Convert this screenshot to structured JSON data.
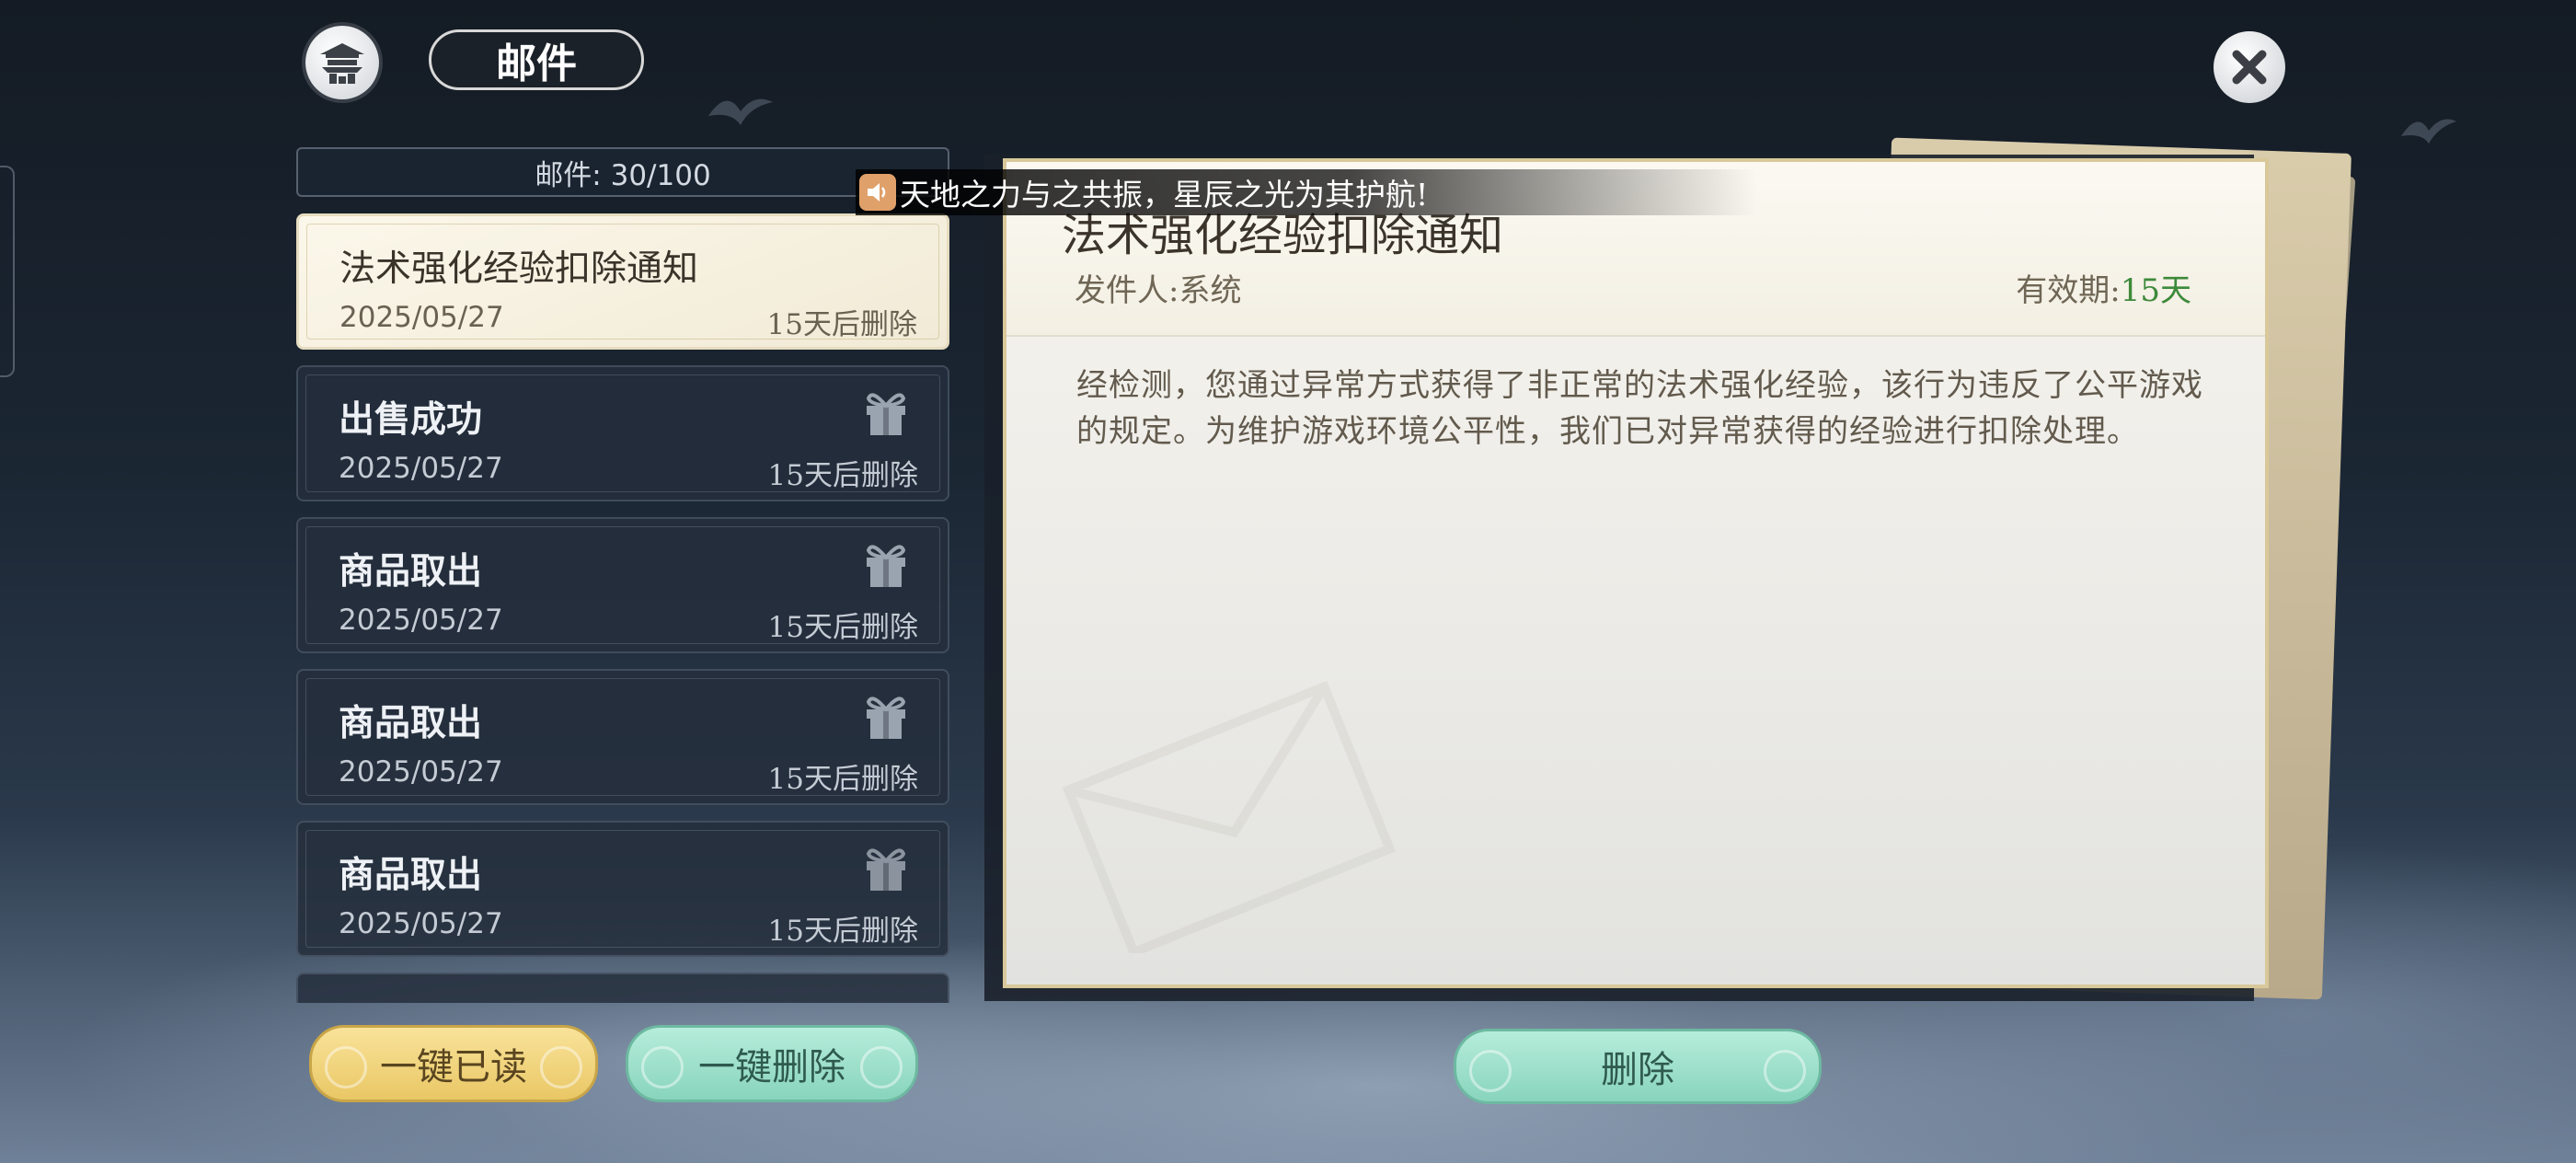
{
  "header": {
    "title": "邮件",
    "icons": {
      "home": "pagoda-icon",
      "close": "close-icon"
    }
  },
  "mailbox": {
    "count_label": "邮件: 30/100",
    "items": [
      {
        "title": "法术强化经验扣除通知",
        "date": "2025/05/27",
        "expire": "15天后删除",
        "selected": true,
        "has_attachment": false
      },
      {
        "title": "出售成功",
        "date": "2025/05/27",
        "expire": "15天后删除",
        "selected": false,
        "has_attachment": true
      },
      {
        "title": "商品取出",
        "date": "2025/05/27",
        "expire": "15天后删除",
        "selected": false,
        "has_attachment": true
      },
      {
        "title": "商品取出",
        "date": "2025/05/27",
        "expire": "15天后删除",
        "selected": false,
        "has_attachment": true
      },
      {
        "title": "商品取出",
        "date": "2025/05/27",
        "expire": "15天后删除",
        "selected": false,
        "has_attachment": true
      }
    ]
  },
  "broadcast": {
    "text": "天地之力与之共振，星辰之光为其护航!",
    "icon": "speaker-icon"
  },
  "detail": {
    "title": "法术强化经验扣除通知",
    "sender": "发件人:系统",
    "valid_label": "有效期:",
    "valid_value": "15天",
    "body": "经检测，您通过异常方式获得了非正常的法术强化经验，该行为违反了公平游戏的规定。为维护游戏环境公平性，我们已对异常获得的经验进行扣除处理。"
  },
  "buttons": {
    "read_all": "一键已读",
    "delete_all": "一键删除",
    "delete": "删除"
  },
  "colors": {
    "valid_green": "#3d8a3a",
    "read_button": "#e9c765",
    "delete_button": "#88d4bc"
  }
}
